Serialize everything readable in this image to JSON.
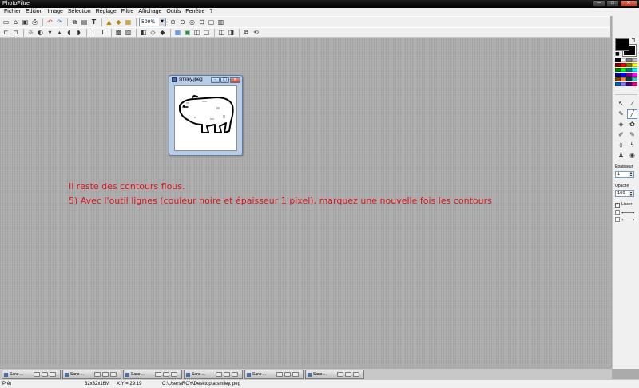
{
  "window": {
    "title": "PhotoFiltre",
    "controls": [
      "–",
      "□",
      "✕"
    ]
  },
  "menu": [
    "Fichier",
    "Edition",
    "Image",
    "Sélection",
    "Réglage",
    "Filtre",
    "Affichage",
    "Outils",
    "Fenêtre",
    "?"
  ],
  "toolbar1": {
    "group1": [
      "new-icon",
      "open-icon",
      "save-icon",
      "print-icon"
    ],
    "group2": [
      "undo-icon",
      "redo-icon"
    ],
    "group3": [
      "copy-icon",
      "paste-icon",
      "text-icon"
    ],
    "group4": [
      "import-icon",
      "export-icon",
      "batch-icon"
    ],
    "zoom_value": "500%",
    "group5": [
      "zoom-in-icon",
      "zoom-out-icon",
      "actual-size-icon",
      "fit-window-icon",
      "fullscreen-icon",
      "preview-icon"
    ]
  },
  "toolbar2_icons": [
    "crop-icon",
    "resize-icon",
    "brightness-icon",
    "contrast-icon",
    "gamma-down-icon",
    "gamma-up-icon",
    "saturation-icon",
    "hue-icon",
    "curve-icon",
    "levels-icon",
    "grayscale-icon",
    "sepia-icon",
    "negative-icon",
    "blur-icon",
    "sharpen-icon",
    "noise-icon",
    "palette-icon",
    "texture-icon",
    "frame-icon",
    "flip-icon",
    "rotate-icon",
    "mirror-icon",
    "deform-icon",
    "layer-icon"
  ],
  "image_window": {
    "title": "smiley.jpeg"
  },
  "tutorial": {
    "line1": "Il reste des contours flous.",
    "line2": "5) Avec l'outil lignes (couleur noire et épaisseur 1 pixel), marquez une nouvelle fois les contours"
  },
  "panel": {
    "swap_glyph": "↰",
    "reset_glyph": "■",
    "colors": {
      "foreground": "#000000",
      "background": "#000000"
    },
    "palette": [
      "#000000",
      "#ffffff",
      "#808080",
      "#c0c0c0",
      "#800000",
      "#ff0000",
      "#808000",
      "#ffff00",
      "#008000",
      "#00ff00",
      "#008080",
      "#00ffff",
      "#000080",
      "#0000ff",
      "#800080",
      "#ff00ff",
      "#804000",
      "#ff8040",
      "#004040",
      "#40c0c0",
      "#0060c0",
      "#8080ff",
      "#400080",
      "#ff0080"
    ],
    "tools": [
      {
        "name": "pointer-tool",
        "glyph": "↖"
      },
      {
        "name": "eyedropper-tool",
        "glyph": "⁄"
      },
      {
        "name": "magic-wand-tool",
        "glyph": "✎"
      },
      {
        "name": "line-tool",
        "glyph": "╱"
      },
      {
        "name": "fill-tool",
        "glyph": "◈"
      },
      {
        "name": "spray-tool",
        "glyph": "✿"
      },
      {
        "name": "brush-tool",
        "glyph": "✐"
      },
      {
        "name": "advanced-brush-tool",
        "glyph": "✎"
      },
      {
        "name": "drop-tool",
        "glyph": "◊"
      },
      {
        "name": "smudge-tool",
        "glyph": "ϟ"
      },
      {
        "name": "stamp-tool",
        "glyph": "♟"
      },
      {
        "name": "shape-tool",
        "glyph": "◉"
      }
    ],
    "thickness_label": "Epaisseur",
    "thickness_value": "1",
    "opacity_label": "Opacité",
    "opacity_value": "100",
    "smooth_label": "Lisser",
    "arrow_glyph": "⟵⟶"
  },
  "tasks": [
    "Sans ...",
    "Sans ...",
    "Sans ...",
    "Sans ...",
    "Sans ...",
    "Sans ..."
  ],
  "status": {
    "state": "Prêt",
    "size": "32x32x16M",
    "coords": "X:Y = 29:19",
    "path": "C:\\Users\\ROY\\Desktop\\a\\smiley.jpeg"
  }
}
